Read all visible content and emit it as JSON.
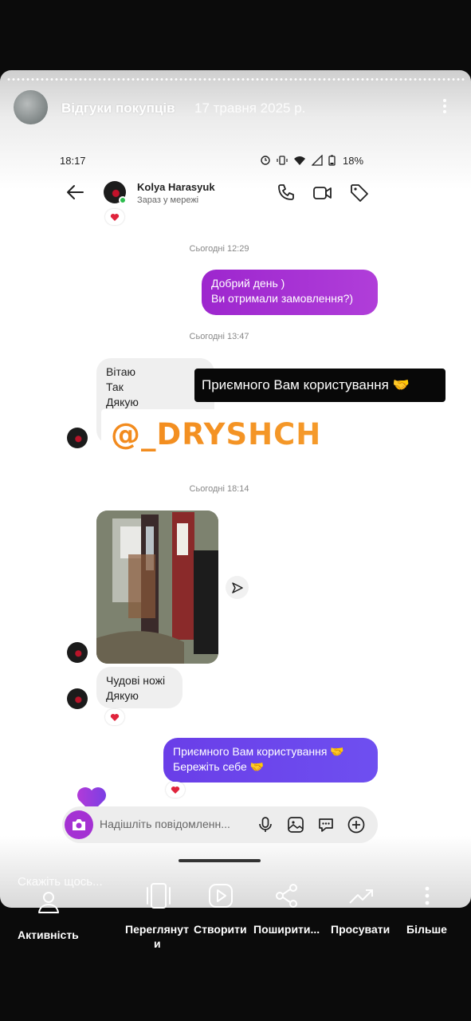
{
  "story": {
    "title": "Відгуки покупців",
    "date": "17 травня 2025 р.",
    "reply_placeholder": "Скажіть щось..."
  },
  "phone_status": {
    "time": "18:17",
    "battery": "18%"
  },
  "chat": {
    "name": "Kolya Harasyuk",
    "status": "Зараз у мережі",
    "messages": {
      "ts1": "Сьогодні 12:29",
      "out1": [
        "Добрий день )",
        "Ви отримали замовлення?)"
      ],
      "ts2": "Сьогодні 13:47",
      "in1": [
        "Вітаю",
        "Так",
        "Дякую"
      ],
      "ts3": "Сьогодні 18:14",
      "in2": [
        "Чудові ножі",
        "Дякую"
      ],
      "out2": [
        "Приємного Вам користування 🤝",
        "Бережіть себе 🤝"
      ]
    },
    "compose_placeholder": "Надішліть повідомленн..."
  },
  "overlay": {
    "caption": "Приємного Вам користування 🤝",
    "threads_handle": "@_DRYSHCH"
  },
  "actions": {
    "activity": "Активність",
    "view_line1": "Переглянут",
    "view_line2": "и",
    "create": "Створити",
    "share": "Поширити...",
    "promote": "Просувати",
    "more": "Більше"
  },
  "colors": {
    "outgoing_purple": "#a431d3",
    "outgoing_blue": "#6a3ee8",
    "threads_orange": "#f28a1d",
    "online": "#2dbd4e"
  },
  "icons": [
    "story-more-icon",
    "back-arrow-icon",
    "phone-icon",
    "video-icon",
    "tag-icon",
    "heart-icon",
    "share-arrow-icon",
    "camera-icon",
    "mic-icon",
    "gallery-icon",
    "sticker-icon",
    "plus-icon",
    "activity-icon",
    "view-icon",
    "create-icon",
    "share-icon",
    "promote-icon",
    "more-icon"
  ]
}
